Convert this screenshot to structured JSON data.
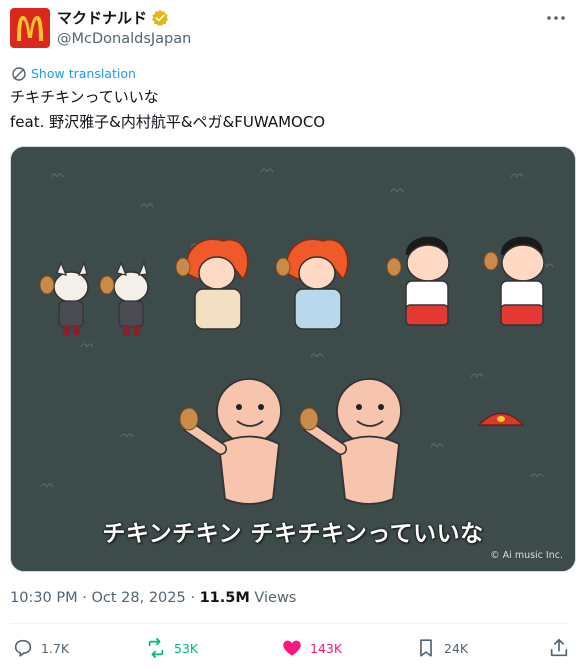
{
  "header": {
    "display_name": "マクドナルド",
    "handle": "@McDonaldsJapan",
    "avatar": "mcdonalds-golden-arches-logo",
    "verified_color": "#e2b719"
  },
  "tweet": {
    "show_translation": "Show translation",
    "line1": "チキチキンっていいな",
    "line2": "feat. 野沢雅子&内村航平&ペガ&FUWAMOCO"
  },
  "media": {
    "caption": "チキンチキン チキチキンっていいな",
    "watermark": "© Ai music Inc."
  },
  "meta": {
    "time": "10:30 PM",
    "date": "Oct 28, 2025",
    "separator": "·",
    "views_count": "11.5M",
    "views_label": "Views"
  },
  "actions": {
    "replies": "1.7K",
    "reposts": "53K",
    "likes": "143K",
    "bookmarks": "24K"
  },
  "colors": {
    "accent": "#1d9bf0",
    "repost": "#00ba7c",
    "like": "#f91880",
    "muted": "#536471",
    "brand_red": "#da291c",
    "brand_yellow": "#ffc72c"
  }
}
